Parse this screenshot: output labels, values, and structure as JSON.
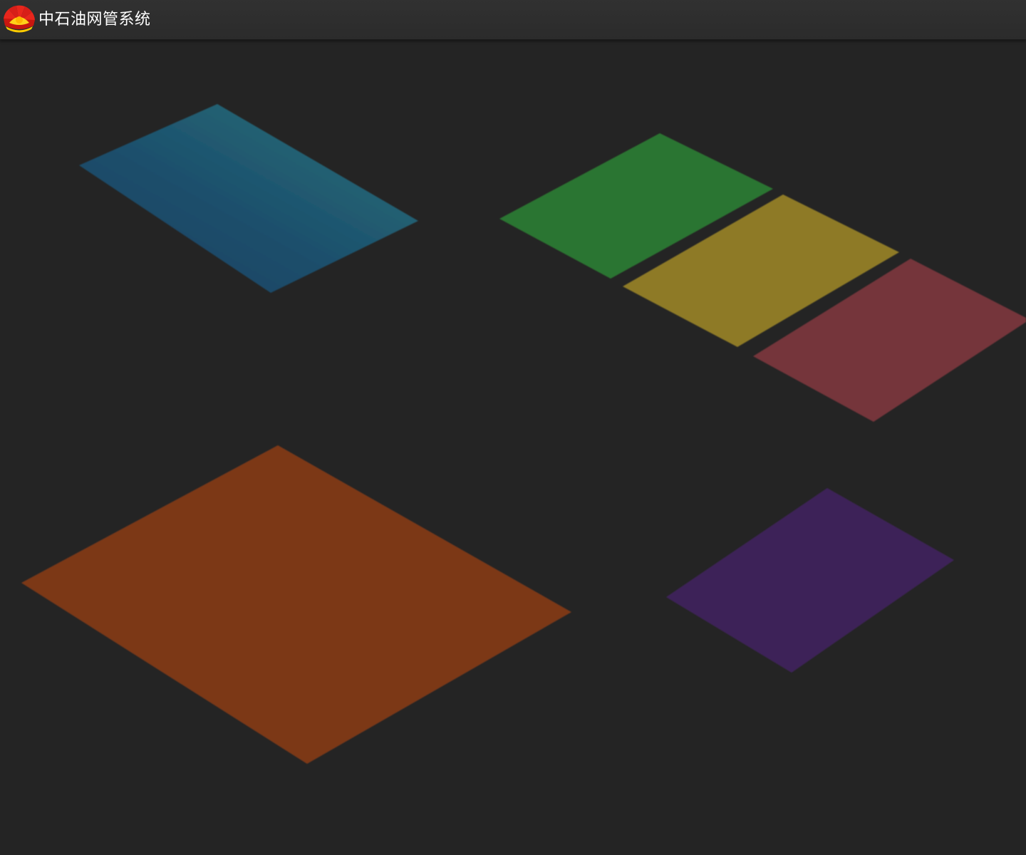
{
  "app": {
    "title": "中石油网管系统",
    "logo_icon": "petrochina-logo-icon"
  },
  "theme": {
    "background": "#242424",
    "topbar": "#2e2e2e",
    "title_color": "#ffffff"
  },
  "tiles": [
    {
      "id": "blue-tile",
      "color": "#1d5a72",
      "gradient_to": "#2a7078"
    },
    {
      "id": "green-tile",
      "color": "#2a7430"
    },
    {
      "id": "yellow-tile",
      "color": "#8e7a28"
    },
    {
      "id": "red-tile",
      "color": "#74353b"
    },
    {
      "id": "orange-tile",
      "color": "#7c3915"
    },
    {
      "id": "purple-tile",
      "color": "#3e2359"
    }
  ]
}
